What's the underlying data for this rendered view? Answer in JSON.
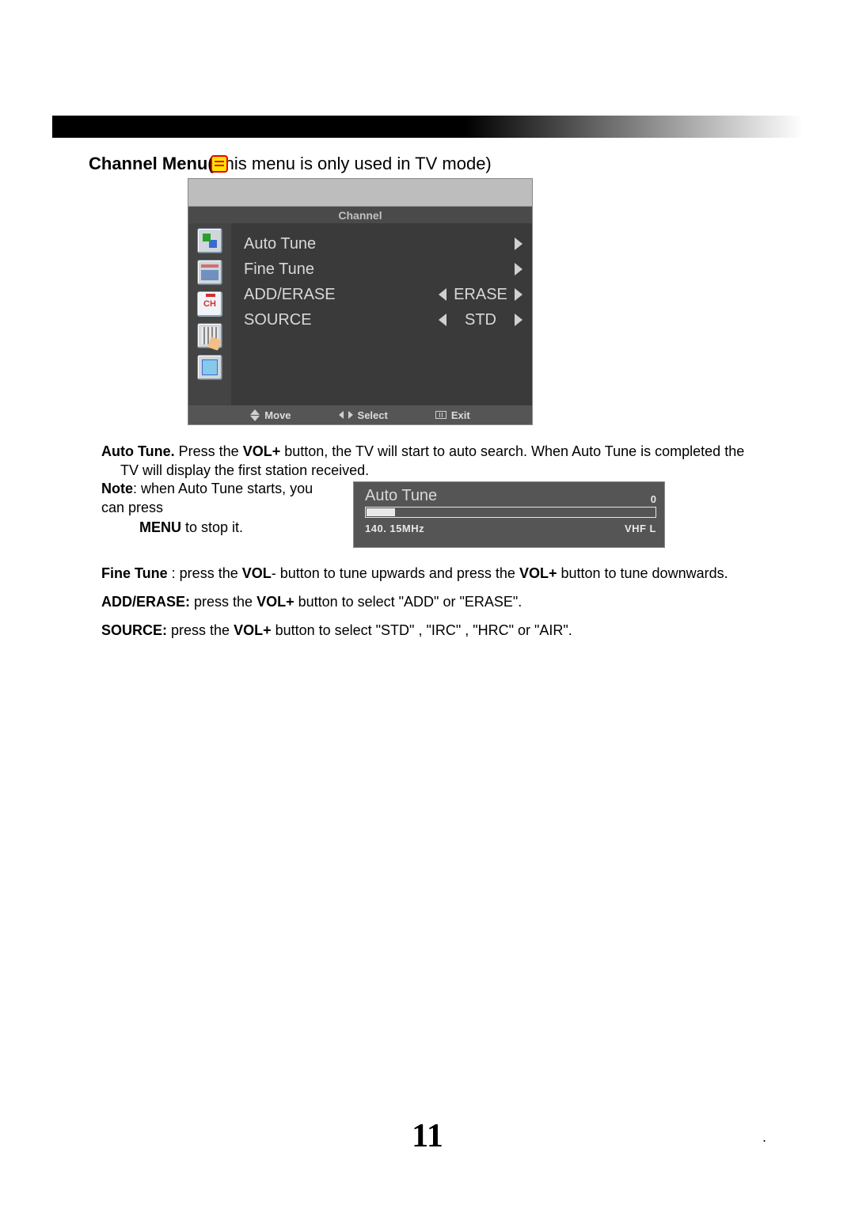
{
  "heading": {
    "bold": "Channel Menu",
    "rest_before": "(",
    "rest_after": "his menu is only used in TV mode)"
  },
  "osd": {
    "title": "Channel",
    "items": [
      {
        "label": "Auto  Tune",
        "value": "",
        "has_left": false,
        "has_right": true
      },
      {
        "label": "Fine  Tune",
        "value": "",
        "has_left": false,
        "has_right": true
      },
      {
        "label": "ADD/ERASE",
        "value": "ERASE",
        "has_left": true,
        "has_right": true
      },
      {
        "label": "SOURCE",
        "value": "STD",
        "has_left": true,
        "has_right": true
      }
    ],
    "footer": {
      "move": "Move",
      "select": "Select",
      "exit": "Exit"
    }
  },
  "text": {
    "auto_tune_bold": "Auto Tune.",
    "auto_tune_rest": " Press the ",
    "vol_plus": "VOL+",
    "auto_tune_rest2": " button, the TV will start to auto search. When Auto Tune is completed the",
    "auto_tune_line2": "TV will display the first station received.",
    "note_bold": "Note",
    "note_rest": ": when Auto Tune starts, you can press",
    "menu_bold": "MENU",
    "menu_rest": " to stop it.",
    "fine_bold": "Fine Tune",
    "fine_rest1": " : press  the ",
    "vol_minus": "VOL",
    "fine_rest2": "- button to tune upwards and press the ",
    "fine_rest3": " button to tune downwards.",
    "ae_bold": "ADD/ERASE:",
    "ae_rest1": " press the ",
    "ae_rest2": " button to select \"ADD\" or \"ERASE\".",
    "src_bold": "SOURCE:",
    "src_rest1": " press the ",
    "src_rest2": " button to select \"STD\" , \"IRC\" , \"HRC\" or \"AIR\".",
    "period": "."
  },
  "progress": {
    "title": "Auto  Tune",
    "zero": "0",
    "freq": "140. 15MHz",
    "band": "VHF  L"
  },
  "page_number": "11"
}
